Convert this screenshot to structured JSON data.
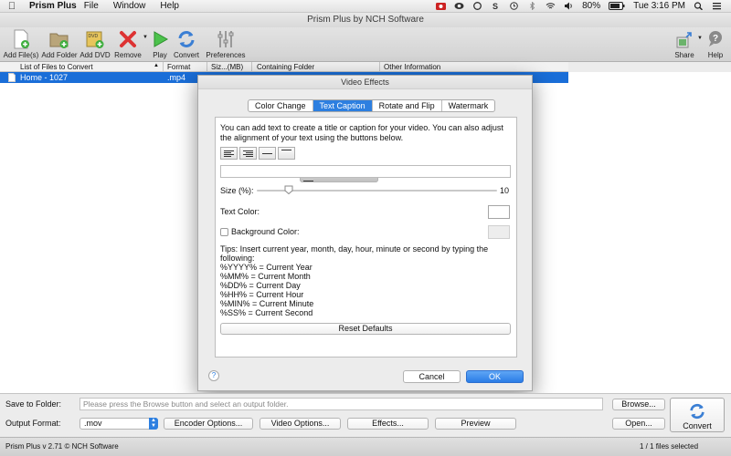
{
  "menubar": {
    "app_name": "Prism Plus",
    "menus": [
      "File",
      "Window",
      "Help"
    ],
    "battery": "80%",
    "clock": "Tue 3:16 PM"
  },
  "window": {
    "title": "Prism Plus by NCH Software"
  },
  "toolbar": {
    "add_files": "Add File(s)",
    "add_folder": "Add Folder",
    "add_dvd": "Add DVD",
    "remove": "Remove",
    "play": "Play",
    "convert": "Convert",
    "preferences": "Preferences",
    "share": "Share",
    "help": "Help"
  },
  "filelist": {
    "columns": [
      "List of Files to Convert",
      "Format",
      "Siz...(MB)",
      "Containing Folder",
      "Other Information"
    ],
    "rows": [
      {
        "name": "Home - 1027",
        "format": ".mp4"
      }
    ]
  },
  "dialog": {
    "title": "Video Effects",
    "tabs": [
      "Color Change",
      "Text Caption",
      "Rotate and Flip",
      "Watermark"
    ],
    "active_tab": "Text Caption",
    "description": "You can add text to create a title or caption for your video. You can also adjust the alignment of your text using the buttons below.",
    "size_label": "Size (%):",
    "size_value": "10",
    "size_fraction": 0.13,
    "text_color_label": "Text Color:",
    "background_color_label": "Background Color:",
    "tips": [
      "Tips: Insert current year, month, day, hour, minute or second by typing the following:",
      "%YYYY% = Current Year",
      "%MM% = Current Month",
      "%DD% = Current Day",
      "%HH% = Current Hour",
      "%MIN% = Current Minute",
      "%SS% = Current Second"
    ],
    "reset_label": "Reset Defaults",
    "help_label": "?",
    "cancel_label": "Cancel",
    "ok_label": "OK"
  },
  "bottom": {
    "save_to_folder_label": "Save to Folder:",
    "folder_placeholder": "Please press the Browse button and select an output folder.",
    "browse_label": "Browse...",
    "output_format_label": "Output Format:",
    "output_format_value": ".mov",
    "encoder_options": "Encoder Options...",
    "video_options": "Video Options...",
    "effects": "Effects...",
    "preview": "Preview",
    "open": "Open...",
    "convert": "Convert"
  },
  "status": {
    "version": "Prism Plus v 2.71 © NCH Software",
    "selection": "1 / 1 files selected"
  },
  "colors": {
    "accent": "#2d7fe0",
    "selection": "#1a6ed8"
  }
}
